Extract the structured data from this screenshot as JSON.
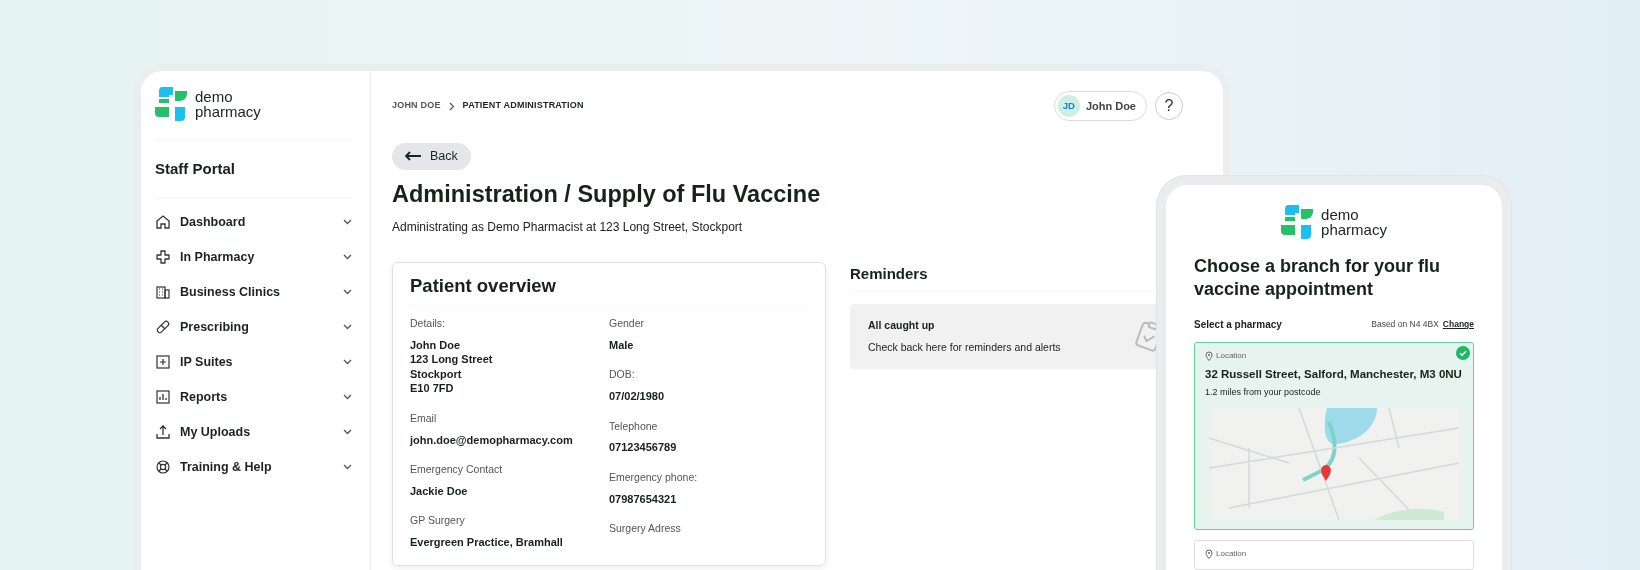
{
  "sidebar": {
    "logo": {
      "line1": "demo",
      "line2": "pharmacy"
    },
    "portal_title": "Staff Portal",
    "items": [
      {
        "label": "Dashboard",
        "kind": "home"
      },
      {
        "label": "In Pharmacy",
        "kind": "cross"
      },
      {
        "label": "Business Clinics",
        "kind": "building"
      },
      {
        "label": "Prescribing",
        "kind": "pill"
      },
      {
        "label": "IP Suites",
        "kind": "plus-square"
      },
      {
        "label": "Reports",
        "kind": "chart"
      },
      {
        "label": "My Uploads",
        "kind": "upload"
      },
      {
        "label": "Training & Help",
        "kind": "lifebuoy"
      }
    ]
  },
  "header": {
    "breadcrumb": [
      "JOHN DOE",
      "PATIENT ADMINISTRATION"
    ],
    "user": {
      "initials": "JD",
      "name": "John Doe"
    },
    "help": "?"
  },
  "back_button": "Back",
  "title": "Administration / Supply of Flu Vaccine",
  "subtitle": "Administrating as Demo Pharmacist at 123 Long Street, Stockport",
  "patient_overview": {
    "title": "Patient overview",
    "columns": [
      [
        {
          "label": "Details:",
          "value": "John Doe\n123 Long Street\nStockport\nE10 7FD"
        },
        {
          "label": "Email",
          "value": "john.doe@demopharmacy.com"
        },
        {
          "label": "Emergency Contact",
          "value": "Jackie Doe"
        },
        {
          "label": "GP Surgery",
          "value": "Evergreen Practice, Bramhall"
        }
      ],
      [
        {
          "label": "Gender",
          "value": "Male"
        },
        {
          "label": "DOB:",
          "value": "07/02/1980"
        },
        {
          "label": "Telephone",
          "value": "07123456789"
        },
        {
          "label": "Emergency phone:",
          "value": "07987654321"
        },
        {
          "label": "Surgery Adress"
        }
      ]
    ]
  },
  "reminders": {
    "title": "Reminders",
    "heading": "All caught up",
    "text": "Check back here for reminders and alerts"
  },
  "mobile": {
    "logo": {
      "line1": "demo",
      "line2": "pharmacy"
    },
    "title": "Choose a branch for your flu vaccine appointment",
    "select_label": "Select a pharmacy",
    "based_on": "Based on N4 4BX",
    "change_link": "Change",
    "branches": [
      {
        "location_label": "Location",
        "address": "32 Russell Street, Salford, Manchester, M3 0NU",
        "distance": "1.2 miles from your postcode",
        "selected": true
      },
      {
        "location_label": "Location",
        "selected": false
      }
    ]
  }
}
